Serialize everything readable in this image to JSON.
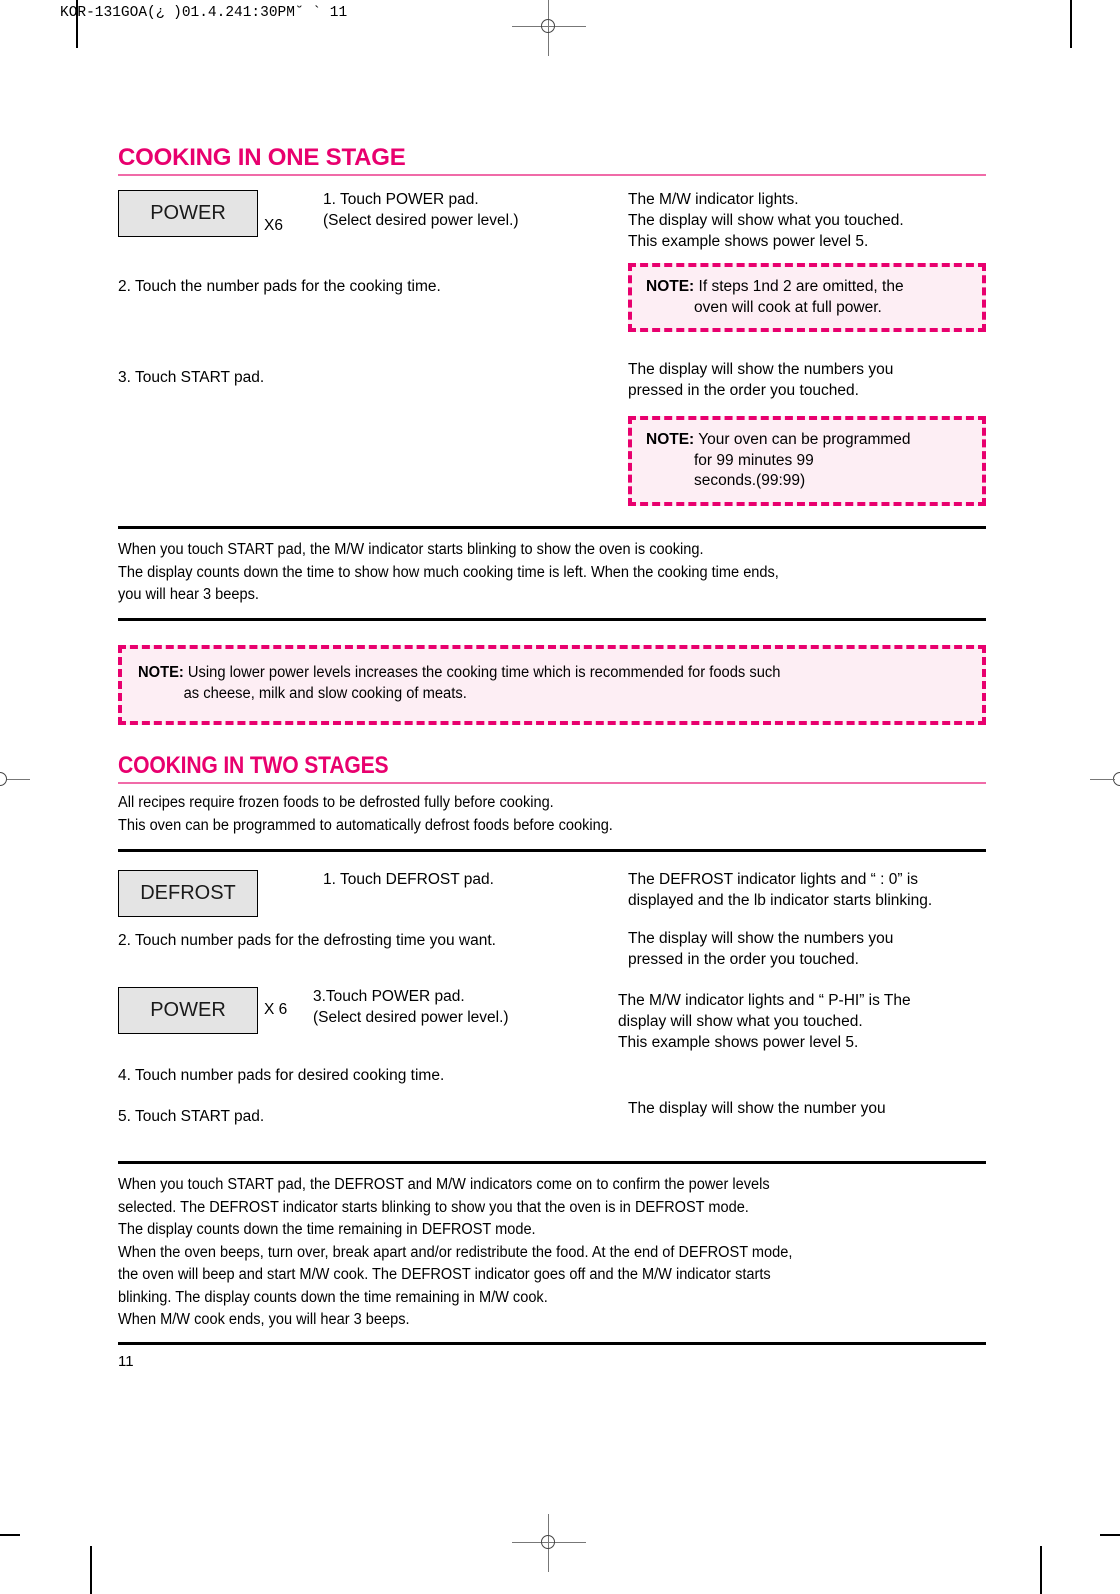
{
  "header": {
    "slug": "KOR-131GOA(¿ )01.4.241:30PM˘ ` 11"
  },
  "section_one": {
    "title": "COOKING IN ONE STAGE",
    "pad_label": "POWER",
    "pad_multiplier": "X6",
    "step1_line1": "1. Touch POWER pad.",
    "step1_line2": "(Select desired power level.)",
    "right1_line1": "The M/W indicator lights.",
    "right1_line2": "The display will show what you touched.",
    "right1_line3": "This example shows power level 5.",
    "note1_label": "NOTE:",
    "note1_line1": "If steps 1nd 2 are omitted, the",
    "note1_line2": "oven will cook at full power.",
    "step2": "2. Touch the number pads for the cooking time.",
    "step3": "3. Touch START pad.",
    "right2_line1": "The display will show the numbers you",
    "right2_line2": "pressed in the order you touched.",
    "note2_label": "NOTE:",
    "note2_line1": "Your oven can be programmed",
    "note2_line2": "for 99 minutes 99",
    "note2_line3": "seconds.(99:99)",
    "summary_line1": "When you touch START pad, the M/W indicator starts blinking to show the oven is cooking.",
    "summary_line2": "The display counts down the time to show how much cooking time is left. When the cooking time ends,",
    "summary_line3": "you will hear 3 beeps.",
    "note3_label": "NOTE:",
    "note3_line1": "Using lower power levels increases the cooking time which is recommended for foods such",
    "note3_line2": "as cheese, milk and slow cooking of meats."
  },
  "section_two": {
    "title": "COOKING IN TWO STAGES",
    "intro_line1": "All recipes require frozen foods to be defrosted fully before cooking.",
    "intro_line2": "This oven can be programmed to automatically defrost foods before cooking.",
    "defrost_pad_label": "DEFROST",
    "power_pad_label": "POWER",
    "power_pad_multiplier": "X 6",
    "step1": "1. Touch DEFROST pad.",
    "step2": "2. Touch number pads for the defrosting time you want.",
    "step3_line1": "3.Touch POWER pad.",
    "step3_line2": "(Select desired power level.)",
    "step4": "4. Touch number pads for desired cooking time.",
    "step5": "5. Touch START pad.",
    "right1_line1": "The DEFROST indicator lights and “ : 0” is",
    "right1_line2": "displayed and the lb indicator starts blinking.",
    "right2_line1": "The display will show the numbers you",
    "right2_line2": "pressed in the order you touched.",
    "right3_line1": "The M/W indicator lights and “ P-HI” is The",
    "right3_line2": "display will show what you touched.",
    "right3_line3": "This example shows power level 5.",
    "right4_line1": "The display will show the number you",
    "summary_line1": "When you touch START pad, the DEFROST and M/W indicators come on to confirm the power levels",
    "summary_line2": "selected. The DEFROST indicator starts blinking to show you that the oven is in DEFROST mode.",
    "summary_line3": "The display counts down the time remaining in DEFROST mode.",
    "summary_line4": "When the oven beeps, turn over, break apart and/or redistribute the food. At the end of DEFROST mode,",
    "summary_line5": "the oven will beep and start M/W cook. The DEFROST indicator goes off and the M/W indicator starts",
    "summary_line6": "blinking. The display counts down the time remaining in M/W cook.",
    "summary_line7": "When M/W cook ends, you will hear 3 beeps."
  },
  "footer": {
    "page_number": "11"
  },
  "colors": {
    "accent": "#e8006e",
    "rule": "#f06ba8",
    "note_bg": "#fdeef4",
    "pad_bg": "#e4e4e4"
  }
}
